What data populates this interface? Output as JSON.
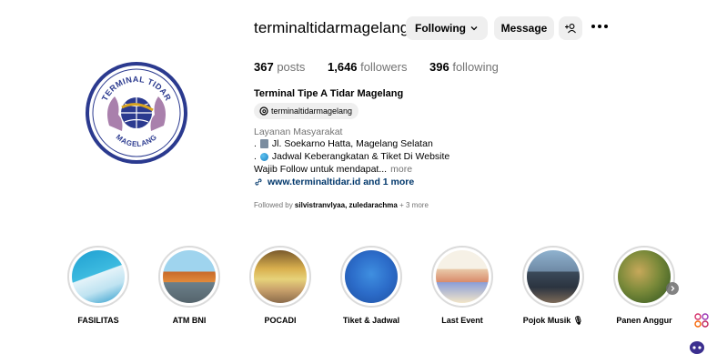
{
  "profile": {
    "username": "terminaltidarmagelang",
    "following_label": "Following",
    "message_label": "Message",
    "posts_count": "367",
    "posts_label": "posts",
    "followers_count": "1,646",
    "followers_label": "followers",
    "following_count": "396",
    "following_count_label": "following",
    "full_name": "Terminal Tipe A Tidar Magelang",
    "threads_handle": "terminaltidarmagelang",
    "category": "Layanan Masyarakat",
    "bio_line_1": "Jl. Soekarno Hatta, Magelang Selatan",
    "bio_line_2": "Jadwal Keberangkatan & Tiket Di Website",
    "bio_line_3": "Wajib Follow untuk mendapat...",
    "bio_more": "more",
    "website": "www.terminaltidar.id and 1 more",
    "followed_by_prefix": "Followed by",
    "followed_by_names": "silvistranvlyaa, zuledarachma",
    "followed_by_suffix": "+ 3 more",
    "avatar_logo_top": "TERMINAL TIDAR",
    "avatar_logo_bottom": "MAGELANG"
  },
  "highlights": [
    {
      "label": "FASILITAS"
    },
    {
      "label": "ATM BNI"
    },
    {
      "label": "POCADI"
    },
    {
      "label": "Tiket & Jadwal"
    },
    {
      "label": "Last Event"
    },
    {
      "label": "Pojok Musik 🎙"
    },
    {
      "label": "Panen Anggur"
    }
  ],
  "colors": {
    "button_bg": "#efefef",
    "link": "#00376b",
    "muted": "#737373",
    "logo_blue": "#2b3a8f",
    "logo_gold": "#d9a520"
  },
  "icons": [
    "chevron-down-icon",
    "add-user-icon",
    "more-icon",
    "threads-icon",
    "building-icon",
    "globe-icon",
    "link-icon",
    "chevron-right-icon",
    "meta-ai-icon",
    "messenger-icon"
  ]
}
